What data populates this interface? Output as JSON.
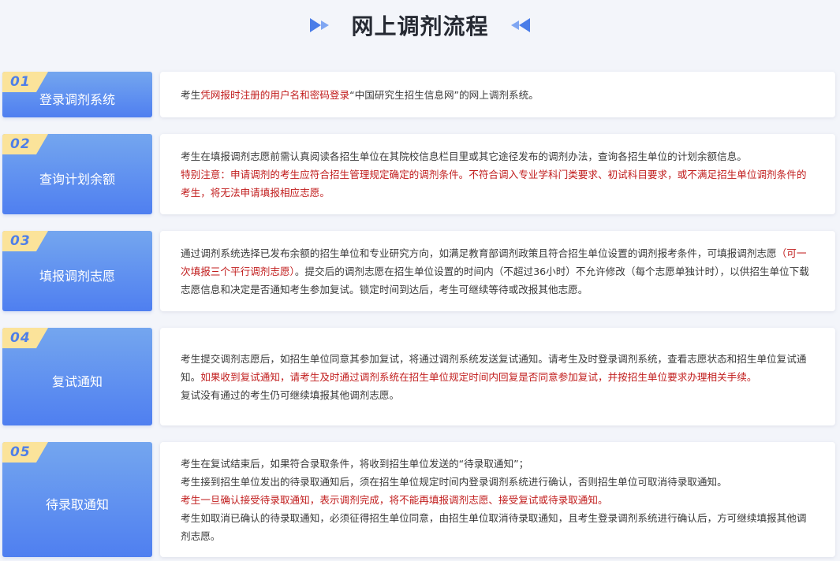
{
  "page": {
    "title": "网上调剂流程"
  },
  "colors": {
    "accent": "#5a8bf0",
    "highlight": "#c11d1d",
    "tab": "#fbe39a"
  },
  "steps": [
    {
      "num": "01",
      "title": "登录调剂系统",
      "lines": [
        [
          {
            "t": "考生",
            "red": false
          },
          {
            "t": "凭网报时注册的用户名和密码登录",
            "red": true
          },
          {
            "t": "“中国研究生招生信息网”的网上调剂系统。",
            "red": false
          }
        ]
      ]
    },
    {
      "num": "02",
      "title": "查询计划余额",
      "lines": [
        [
          {
            "t": "考生在填报调剂志愿前需认真阅读各招生单位在其院校信息栏目里或其它途径发布的调剂办法，查询各招生单位的计划余额信息。",
            "red": false
          }
        ],
        [
          {
            "t": "特别注意：申请调剂的考生应符合招生管理规定确定的调剂条件。不符合调入专业学科门类要求、初试科目要求，或不满足招生单位调剂条件的考生，将无法申请填报相应志愿。",
            "red": true
          }
        ]
      ]
    },
    {
      "num": "03",
      "title": "填报调剂志愿",
      "lines": [
        [
          {
            "t": "通过调剂系统选择已发布余额的招生单位和专业研究方向，如满足教育部调剂政策且符合招生单位设置的调剂报考条件，可填报调剂志愿",
            "red": false
          },
          {
            "t": "（可一次填报三个平行调剂志愿）",
            "red": true
          },
          {
            "t": "。提交后的调剂志愿在招生单位设置的时间内（不超过36小时）不允许修改（每个志愿单独计时），以供招生单位下载志愿信息和决定是否通知考生参加复试。锁定时间到达后，考生可继续等待或改报其他志愿。",
            "red": false
          }
        ]
      ]
    },
    {
      "num": "04",
      "title": "复试通知",
      "lines": [
        [
          {
            "t": "考生提交调剂志愿后，如招生单位同意其参加复试，将通过调剂系统发送复试通知。请考生及时登录调剂系统，查看志愿状态和招生单位复试通知。",
            "red": false
          },
          {
            "t": "如果收到复试通知，请考生及时通过调剂系统在招生单位规定时间内回复是否同意参加复试，并按招生单位要求办理相关手续。",
            "red": true
          }
        ],
        [
          {
            "t": "复试没有通过的考生仍可继续填报其他调剂志愿。",
            "red": false
          }
        ]
      ]
    },
    {
      "num": "05",
      "title": "待录取通知",
      "lines": [
        [
          {
            "t": "考生在复试结束后，如果符合录取条件，将收到招生单位发送的“待录取通知”；",
            "red": false
          }
        ],
        [
          {
            "t": "考生接到招生单位发出的待录取通知后，须在招生单位规定时间内登录调剂系统进行确认，否则招生单位可取消待录取通知。",
            "red": false
          }
        ],
        [
          {
            "t": "考生一旦确认接受待录取通知，表示调剂完成，将不能再填报调剂志愿、接受复试或待录取通知。",
            "red": true
          }
        ],
        [
          {
            "t": "考生如取消已确认的待录取通知，必须征得招生单位同意，由招生单位取消待录取通知，且考生登录调剂系统进行确认后，方可继续填报其他调剂志愿。",
            "red": false
          }
        ]
      ]
    }
  ]
}
